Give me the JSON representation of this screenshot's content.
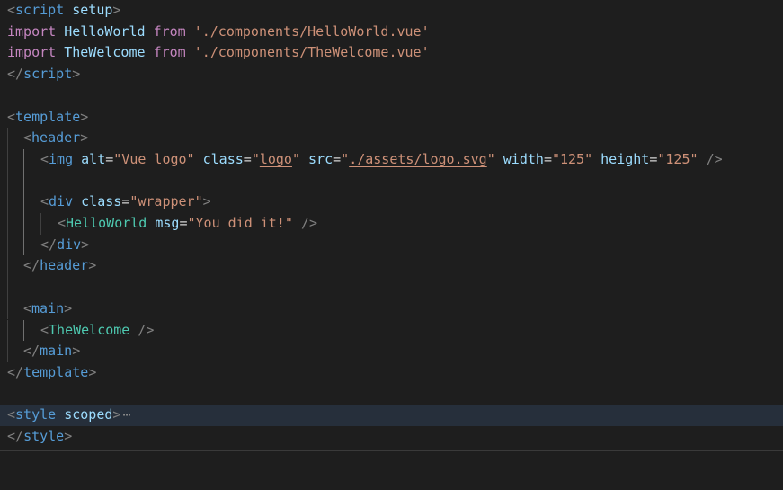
{
  "code": {
    "script_open_lt": "<",
    "script_tag": "script",
    "setup_attr": "setup",
    "script_open_gt": ">",
    "import_kw": "import",
    "helloworld_ident": "HelloWorld",
    "from_kw": "from",
    "helloworld_path": "'./components/HelloWorld.vue'",
    "thewelcome_ident": "TheWelcome",
    "thewelcome_path": "'./components/TheWelcome.vue'",
    "script_close": "</",
    "script_close_gt": ">",
    "template_tag": "template",
    "header_tag": "header",
    "img_tag": "img",
    "alt_attr": "alt",
    "alt_value": "\"Vue logo\"",
    "class_attr": "class",
    "logo_class": "logo",
    "src_attr": "src",
    "src_value": "./assets/logo.svg",
    "width_attr": "width",
    "width_value": "\"125\"",
    "height_attr": "height",
    "height_value": "\"125\"",
    "self_close": "/>",
    "div_tag": "div",
    "wrapper_class": "wrapper",
    "helloworld_comp": "HelloWorld",
    "msg_attr": "msg",
    "msg_value": "\"You did it!\"",
    "main_tag": "main",
    "thewelcome_comp": "TheWelcome",
    "style_tag": "style",
    "scoped_attr": "scoped",
    "fold_ellipsis": "⋯",
    "quote": "\"",
    "equals": "="
  }
}
